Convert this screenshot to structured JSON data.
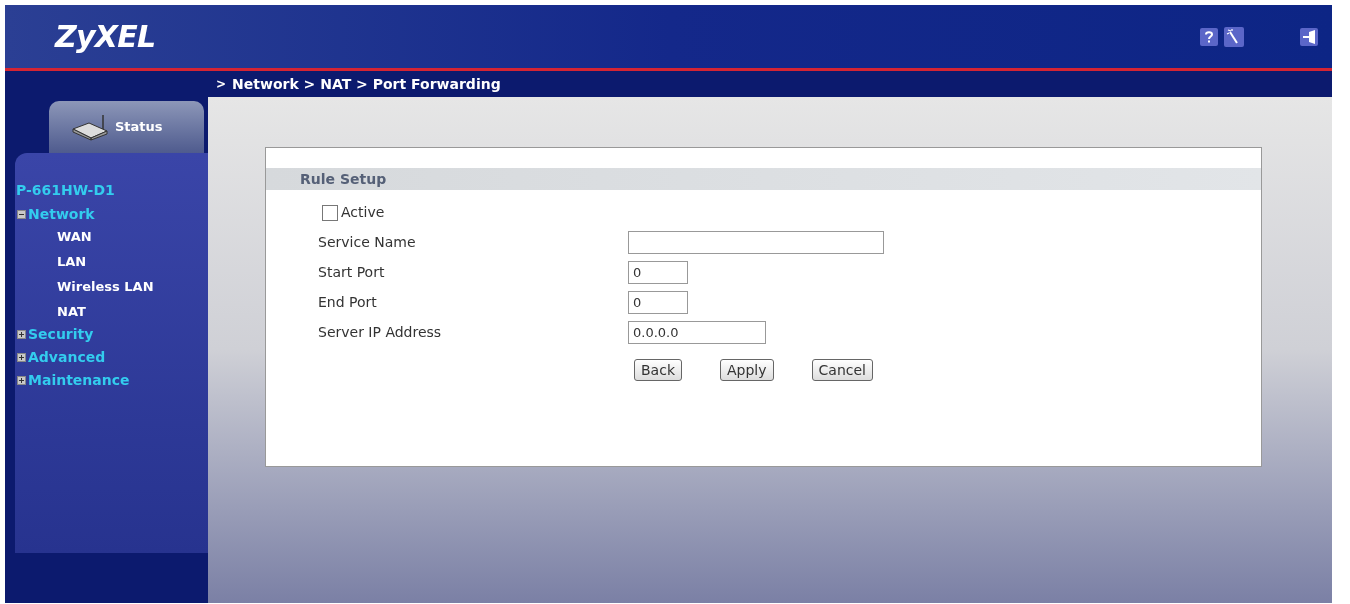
{
  "header": {
    "logo": "ZyXEL"
  },
  "breadcrumb": {
    "marker": ">",
    "path": "Network > NAT > Port Forwarding"
  },
  "sidebar": {
    "status_tab": "Status",
    "device": "P-661HW-D1",
    "tree": [
      {
        "label": "Network",
        "expanded": true,
        "children": [
          {
            "label": "WAN"
          },
          {
            "label": "LAN"
          },
          {
            "label": "Wireless LAN"
          },
          {
            "label": "NAT"
          }
        ]
      },
      {
        "label": "Security",
        "expanded": false
      },
      {
        "label": "Advanced",
        "expanded": false
      },
      {
        "label": "Maintenance",
        "expanded": false
      }
    ]
  },
  "panel": {
    "title": "Rule Setup",
    "active": {
      "label": "Active",
      "checked": false
    },
    "fields": [
      {
        "label": "Service Name"
      },
      {
        "label": "Start Port",
        "value": "0"
      },
      {
        "label": "End Port",
        "value": "0"
      },
      {
        "label": "Server IP Address",
        "value": "0.0.0.0"
      }
    ],
    "buttons": [
      "Back",
      "Apply",
      "Cancel"
    ]
  }
}
